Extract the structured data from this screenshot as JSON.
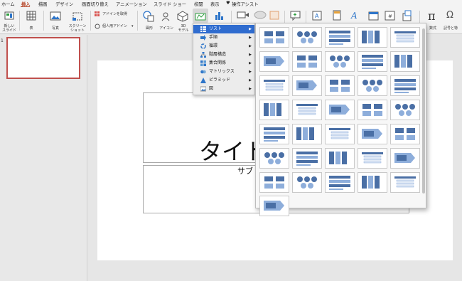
{
  "menu": {
    "tabs": [
      "ホーム",
      "挿入",
      "描画",
      "デザイン",
      "画面切り替え",
      "アニメーション",
      "スライド ショー",
      "校閲",
      "表示"
    ],
    "assist": "操作アシスト"
  },
  "ribbon": {
    "new_slide": [
      "新しい",
      "スライド"
    ],
    "table": "表",
    "photo": "写真",
    "screenshot": [
      "スクリーン",
      "ショット"
    ],
    "get_addins": "アドインを取得",
    "my_addins": "個人用アドイン",
    "shapes": "図形",
    "icons": "アイコン",
    "model3d": [
      "3D",
      "モデル"
    ],
    "equation": "数式",
    "symbol": "記号と特"
  },
  "smartart_menu": {
    "items": [
      {
        "label": "リスト",
        "icon": "list-icon",
        "selected": true
      },
      {
        "label": "手順",
        "icon": "process-icon",
        "selected": false
      },
      {
        "label": "循環",
        "icon": "cycle-icon",
        "selected": false
      },
      {
        "label": "階層構造",
        "icon": "hierarchy-icon",
        "selected": false
      },
      {
        "label": "集合関係",
        "icon": "relationship-icon",
        "selected": false
      },
      {
        "label": "マトリックス",
        "icon": "matrix-icon",
        "selected": false
      },
      {
        "label": "ピラミッド",
        "icon": "pyramid-icon",
        "selected": false
      },
      {
        "label": "図",
        "icon": "picture-icon",
        "selected": false
      }
    ]
  },
  "slide": {
    "title": "タイト",
    "subtitle": "サブ",
    "number": "1"
  }
}
